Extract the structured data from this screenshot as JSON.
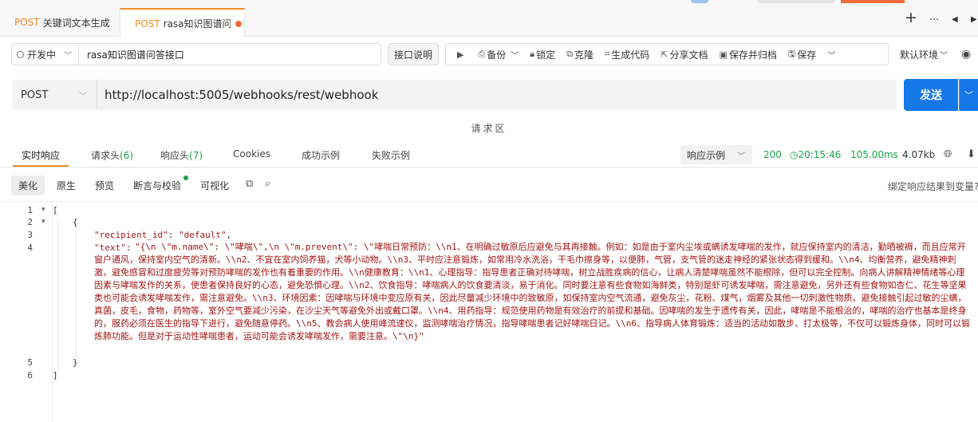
{
  "tabs": [
    {
      "method": "POST",
      "title": "关键词文本生成"
    },
    {
      "method": "POST",
      "title": "rasa知识图谱问答"
    }
  ],
  "toolbar": {
    "environment": "开发中",
    "api_name": "rasa知识图谱问答接口",
    "doc_button": "接口说明",
    "actions": {
      "backup": "备份",
      "lock": "锁定",
      "clone": "克隆",
      "gen_code": "生成代码",
      "share_doc": "分享文档",
      "save_archive": "保存并归档",
      "save": "保存"
    },
    "default_env": "默认环境"
  },
  "request": {
    "method": "POST",
    "url": "http://localhost:5005/webhooks/rest/webhook",
    "send_label": "发送",
    "area_label": "请求区"
  },
  "response_tabs": {
    "realtime": "实时响应",
    "req_headers": "请求头",
    "req_headers_count": "(6)",
    "resp_headers": "响应头",
    "resp_headers_count": "(7)",
    "cookies": "Cookies",
    "success_example": "成功示例",
    "fail_example": "失败示例",
    "example_select": "响应示例",
    "status_code": "200",
    "time": "20:15:46",
    "duration": "105.00ms",
    "size": "4.07kb"
  },
  "view_tabs": {
    "pretty": "美化",
    "raw": "原生",
    "preview": "预览",
    "assert": "断言与校验",
    "visualize": "可视化",
    "bind_var": "绑定响应结果到变量?"
  },
  "code": {
    "line_numbers": [
      "1",
      "2",
      "3",
      "4",
      "5",
      "6"
    ],
    "open_bracket": "[",
    "open_brace": "{",
    "recipient_key": "\"recipient_id\"",
    "recipient_val": "\"default\"",
    "text_key": "\"text\"",
    "text_val": "\"{\\n    \\\"m.name\\\": \\\"哮喘\\\",\\n    \\\"m.prevent\\\": \\\"哮喘日常预防：\\\\n1、在明确过敏原后应避免与其再接触。例如：如是由于室内尘埃或螨诱发哮喘的发作，就应保持室内的清洁，勤晒被褥，而且应常开窗户通风，保持室内空气的清新。\\\\n2、不宜在室内饲养猫，犬等小动物。\\\\n3、平时应注意锻炼，如常用冷水洗浴，干毛巾擦身等，以便肺，气管，支气管的迷走神经的紧张状态得到缓和。\\\\n4、均衡营养，避免精神刺激，避免感冒和过度疲劳等对预防哮喘的发作也有着重要的作用。\\\\n健康教育：\\\\n1、心理指导：指导患者正确对待哮喘，树立战胜疾病的信心，让病人清楚哮喘虽然不能根除，但可以完全控制。向病人讲解精神情绪等心理因素与哮喘发作的关系，使患者保持良好的心态，避免恐惧心理。\\\\n2、饮食指导：哮喘病人的饮食要清淡，易于消化。同时要注意有些食物如海鲜类，特别是虾可诱发哮喘，需注意避免，另外还有些食物如杏仁、花生等坚果类也可能会诱发哮喘发作，需注意避免。\\\\n3、环境因素：因哮喘与环境中变应原有关，因此尽量减少环境中的致敏原，如保持室内空气流通，避免灰尘，花粉、煤气，烟雾及其他一切刺激性物质。避免接触引起过敏的尘螨，真菌，皮毛，食物，药物等，室外空气要减少污染，在沙尘天气等避免外出或戴口罩。\\\\n4、用药指导：规范使用药物是有效治疗的前提和基础。因哮喘的发生于遗传有关，因此，哮喘是不能根治的，哮喘的治疗也基本是终身的，服药必须在医生的指导下进行，避免随意停药。\\\\n5、教会病人使用峰流速仪，监测哮喘治疗情况，指导哮喘患者记好哮喘日记。\\\\n6、指导病人体育锻炼：适当的活动如散步、打太极等，不仅可以锻炼身体，同时可以锻炼肺功能。但是对于运动性哮喘患者，运动可能会诱发哮喘发作，需要注意。\\\"\\n}\"",
    "close_brace": "}",
    "close_bracket": "]"
  },
  "colors": {
    "accent": "#f08a24",
    "primary": "#1677e8",
    "success": "#1aa34a",
    "json_string": "#a31515"
  }
}
